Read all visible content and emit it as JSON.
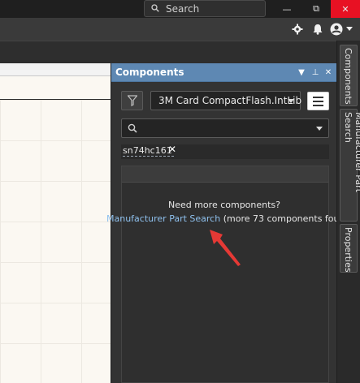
{
  "titlebar": {
    "search_text": "Search",
    "minimize_glyph": "—",
    "restore_glyph": "⧉",
    "close_glyph": "✕"
  },
  "toolbar": {
    "icons": [
      "gear-icon",
      "bell-icon",
      "user-icon",
      "caret-down-icon"
    ]
  },
  "panel": {
    "title": "Components",
    "header_buttons": [
      "▼",
      "⊥",
      "✕"
    ],
    "library": "3M Card CompactFlash.IntLib",
    "search_value": "",
    "filter_chip": "sn74hc161",
    "need_more_text": "Need more components?",
    "link_text": "Manufacturer Part Search",
    "more_text": "(more 73 components fou"
  },
  "side_tabs": [
    {
      "label": "Components"
    },
    {
      "label": "Manufacturer Part Search"
    },
    {
      "label": "Properties"
    }
  ],
  "colors": {
    "panel_header": "#5e88b3",
    "link": "#8fc1ee",
    "arrow": "#e53935",
    "close_button": "#e81123"
  }
}
